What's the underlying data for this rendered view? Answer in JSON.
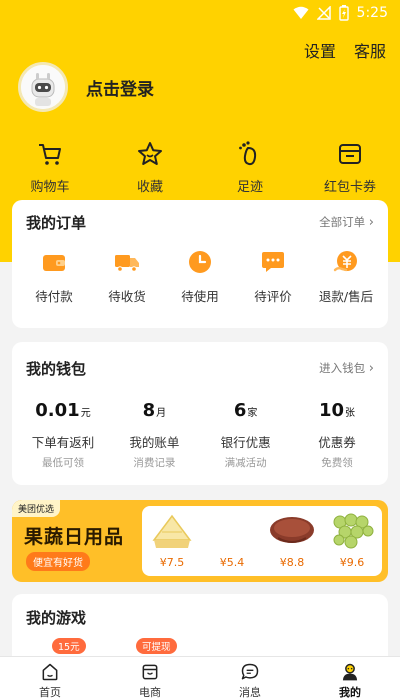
{
  "status_bar": {
    "time": "5:25"
  },
  "header": {
    "settings_label": "设置",
    "service_label": "客服",
    "login_text": "点击登录"
  },
  "quick_links": [
    {
      "label": "购物车",
      "icon": "cart-icon"
    },
    {
      "label": "收藏",
      "icon": "star-icon"
    },
    {
      "label": "足迹",
      "icon": "footprint-icon"
    },
    {
      "label": "红包卡券",
      "icon": "coupon-icon"
    }
  ],
  "orders": {
    "title": "我的订单",
    "all_link": "全部订单",
    "items": [
      {
        "label": "待付款",
        "icon": "wallet-icon"
      },
      {
        "label": "待收货",
        "icon": "truck-icon"
      },
      {
        "label": "待使用",
        "icon": "clock-icon"
      },
      {
        "label": "待评价",
        "icon": "comment-icon"
      },
      {
        "label": "退款/售后",
        "icon": "refund-icon"
      }
    ]
  },
  "wallet": {
    "title": "我的钱包",
    "enter_link": "进入钱包",
    "items": [
      {
        "value": "0.01",
        "unit": "元",
        "name": "下单有返利",
        "sub": "最低可领"
      },
      {
        "value": "8",
        "unit": "月",
        "name": "我的账单",
        "sub": "消费记录"
      },
      {
        "value": "6",
        "unit": "家",
        "name": "银行优惠",
        "sub": "满减活动"
      },
      {
        "value": "10",
        "unit": "张",
        "name": "优惠券",
        "sub": "免费领"
      }
    ]
  },
  "banner": {
    "tag": "美团优选",
    "title": "果蔬日用品",
    "subtitle": "便宜有好货",
    "goods": [
      {
        "price": "¥7.5",
        "icon": "cake-icon"
      },
      {
        "price": "¥5.4",
        "icon": "soap-icon"
      },
      {
        "price": "¥8.8",
        "icon": "meat-icon"
      },
      {
        "price": "¥9.6",
        "icon": "grape-icon"
      }
    ]
  },
  "games": {
    "title": "我的游戏",
    "badges": [
      "15元",
      "可提现"
    ]
  },
  "tabbar": [
    {
      "label": "首页",
      "icon": "home-icon",
      "active": false
    },
    {
      "label": "电商",
      "icon": "shop-icon",
      "active": false
    },
    {
      "label": "消息",
      "icon": "message-icon",
      "active": false
    },
    {
      "label": "我的",
      "icon": "profile-icon",
      "active": true
    }
  ],
  "colors": {
    "brand_yellow": "#ffd200",
    "accent_orange": "#ff9a1f",
    "banner_yellow": "#ffbf28"
  }
}
